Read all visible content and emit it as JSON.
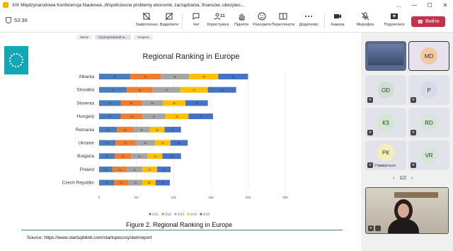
{
  "window": {
    "title": "XIX Międzynarodowa Konferencja Naukowa „Współczesne problemy ekonomii, zarządzania, finansów, ubezpiec...",
    "controls": [
      "...",
      "—",
      "☐",
      "✕"
    ]
  },
  "toolbar": {
    "timer": "53:36",
    "buttons": [
      {
        "label": "Закріплення",
        "icon": "pin-off-icon"
      },
      {
        "label": "Відкріпити",
        "icon": "unpin-icon"
      },
      {
        "label": "Чат",
        "icon": "chat-icon"
      },
      {
        "label": "Користувачі",
        "icon": "people-icon",
        "count": "11"
      },
      {
        "label": "Підняти",
        "icon": "raise-hand-icon"
      },
      {
        "label": "Реагувати",
        "icon": "react-icon"
      },
      {
        "label": "Переглянути",
        "icon": "view-icon"
      },
      {
        "label": "Додатково",
        "icon": "more-icon"
      },
      {
        "label": "Камера",
        "icon": "camera-icon"
      },
      {
        "label": "Мікрофон",
        "icon": "mic-off-icon"
      },
      {
        "label": "Поділитися",
        "icon": "share-icon"
      }
    ],
    "leave_label": "Вийти"
  },
  "slide": {
    "tabs": [
      "Меню",
      "Корпоративний ш...",
      "Спарить"
    ],
    "figure_caption": "Figure 2. Regional Ranking in Europe",
    "source": "Source: https://www.startupblink.com/startupecosystemreport"
  },
  "chart_data": {
    "type": "bar",
    "orientation": "horizontal",
    "stacked": true,
    "title": "Regional Ranking in Europe",
    "categories": [
      "Albania",
      "Slovakia",
      "Slovenia",
      "Hungary",
      "Romania",
      "Ukraine",
      "Bulgaria",
      "Poland",
      "Czech Republic"
    ],
    "series": [
      {
        "name": "2021",
        "color": "#4a7ebb",
        "values": [
          42,
          37,
          29,
          29,
          24,
          22,
          21,
          18,
          20
        ]
      },
      {
        "name": "2022",
        "color": "#ed7d31",
        "values": [
          41,
          35,
          28,
          29,
          22,
          27,
          22,
          19,
          19
        ]
      },
      {
        "name": "2023",
        "color": "#a5a5a5",
        "values": [
          38,
          37,
          29,
          31,
          22,
          26,
          22,
          21,
          19
        ]
      },
      {
        "name": "2024",
        "color": "#ffc000",
        "values": [
          39,
          37,
          30,
          31,
          20,
          21,
          20,
          20,
          18
        ]
      },
      {
        "name": "2025",
        "color": "#4472c4",
        "values": [
          40,
          38,
          30,
          33,
          22,
          23,
          25,
          18,
          19
        ]
      }
    ],
    "xlim": [
      0,
      250
    ],
    "xticks": [
      "0",
      "50",
      "100",
      "150",
      "200",
      "250"
    ],
    "legend_position": "bottom"
  },
  "participants": {
    "tiles": [
      {
        "initials": "",
        "kind": "video"
      },
      {
        "initials": "MD",
        "color": "#f2c9a0"
      },
      {
        "initials": "OD",
        "color": "#cfe0d2"
      },
      {
        "initials": "P",
        "color": "#d5dbe8"
      },
      {
        "initials": "КЗ",
        "color": "#cfe8cf"
      },
      {
        "initials": "RD",
        "color": "#d4e6d4"
      },
      {
        "initials": "РК",
        "color": "#f4efb8",
        "label": "Утримується"
      },
      {
        "initials": "VR",
        "color": "#d4e6d4"
      }
    ],
    "pager": "1/2"
  }
}
